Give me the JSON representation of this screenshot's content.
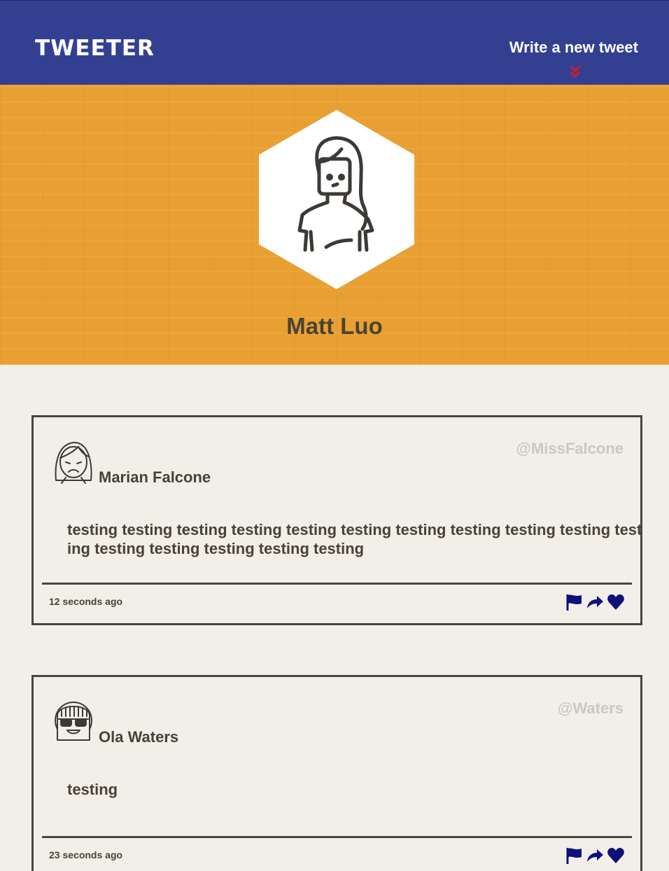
{
  "nav": {
    "brand": "TWEETER",
    "compose_label": "Write a new tweet",
    "compose_icon": "double-chevron-down-icon",
    "compose_icon_color": "#e0171b"
  },
  "profile": {
    "name": "Matt Luo",
    "avatar_icon": "woman-avatar-icon",
    "hero_color": "#e9a033"
  },
  "tweets": [
    {
      "name": "Marian Falcone",
      "handle": "@MissFalcone",
      "avatar_icon": "woman-frowning-avatar-icon",
      "content": "testing testing testing testing testing testing testing testing testing testing testing testing testing testing testing testing",
      "time": "12 seconds ago"
    },
    {
      "name": "Ola Waters",
      "handle": "@Waters",
      "avatar_icon": "woman-sunglasses-avatar-icon",
      "content": "testing",
      "time": "23 seconds ago"
    }
  ],
  "actions": {
    "flag_icon": "flag-icon",
    "retweet_icon": "retweet-icon",
    "like_icon": "heart-icon",
    "color": "#10107a"
  }
}
